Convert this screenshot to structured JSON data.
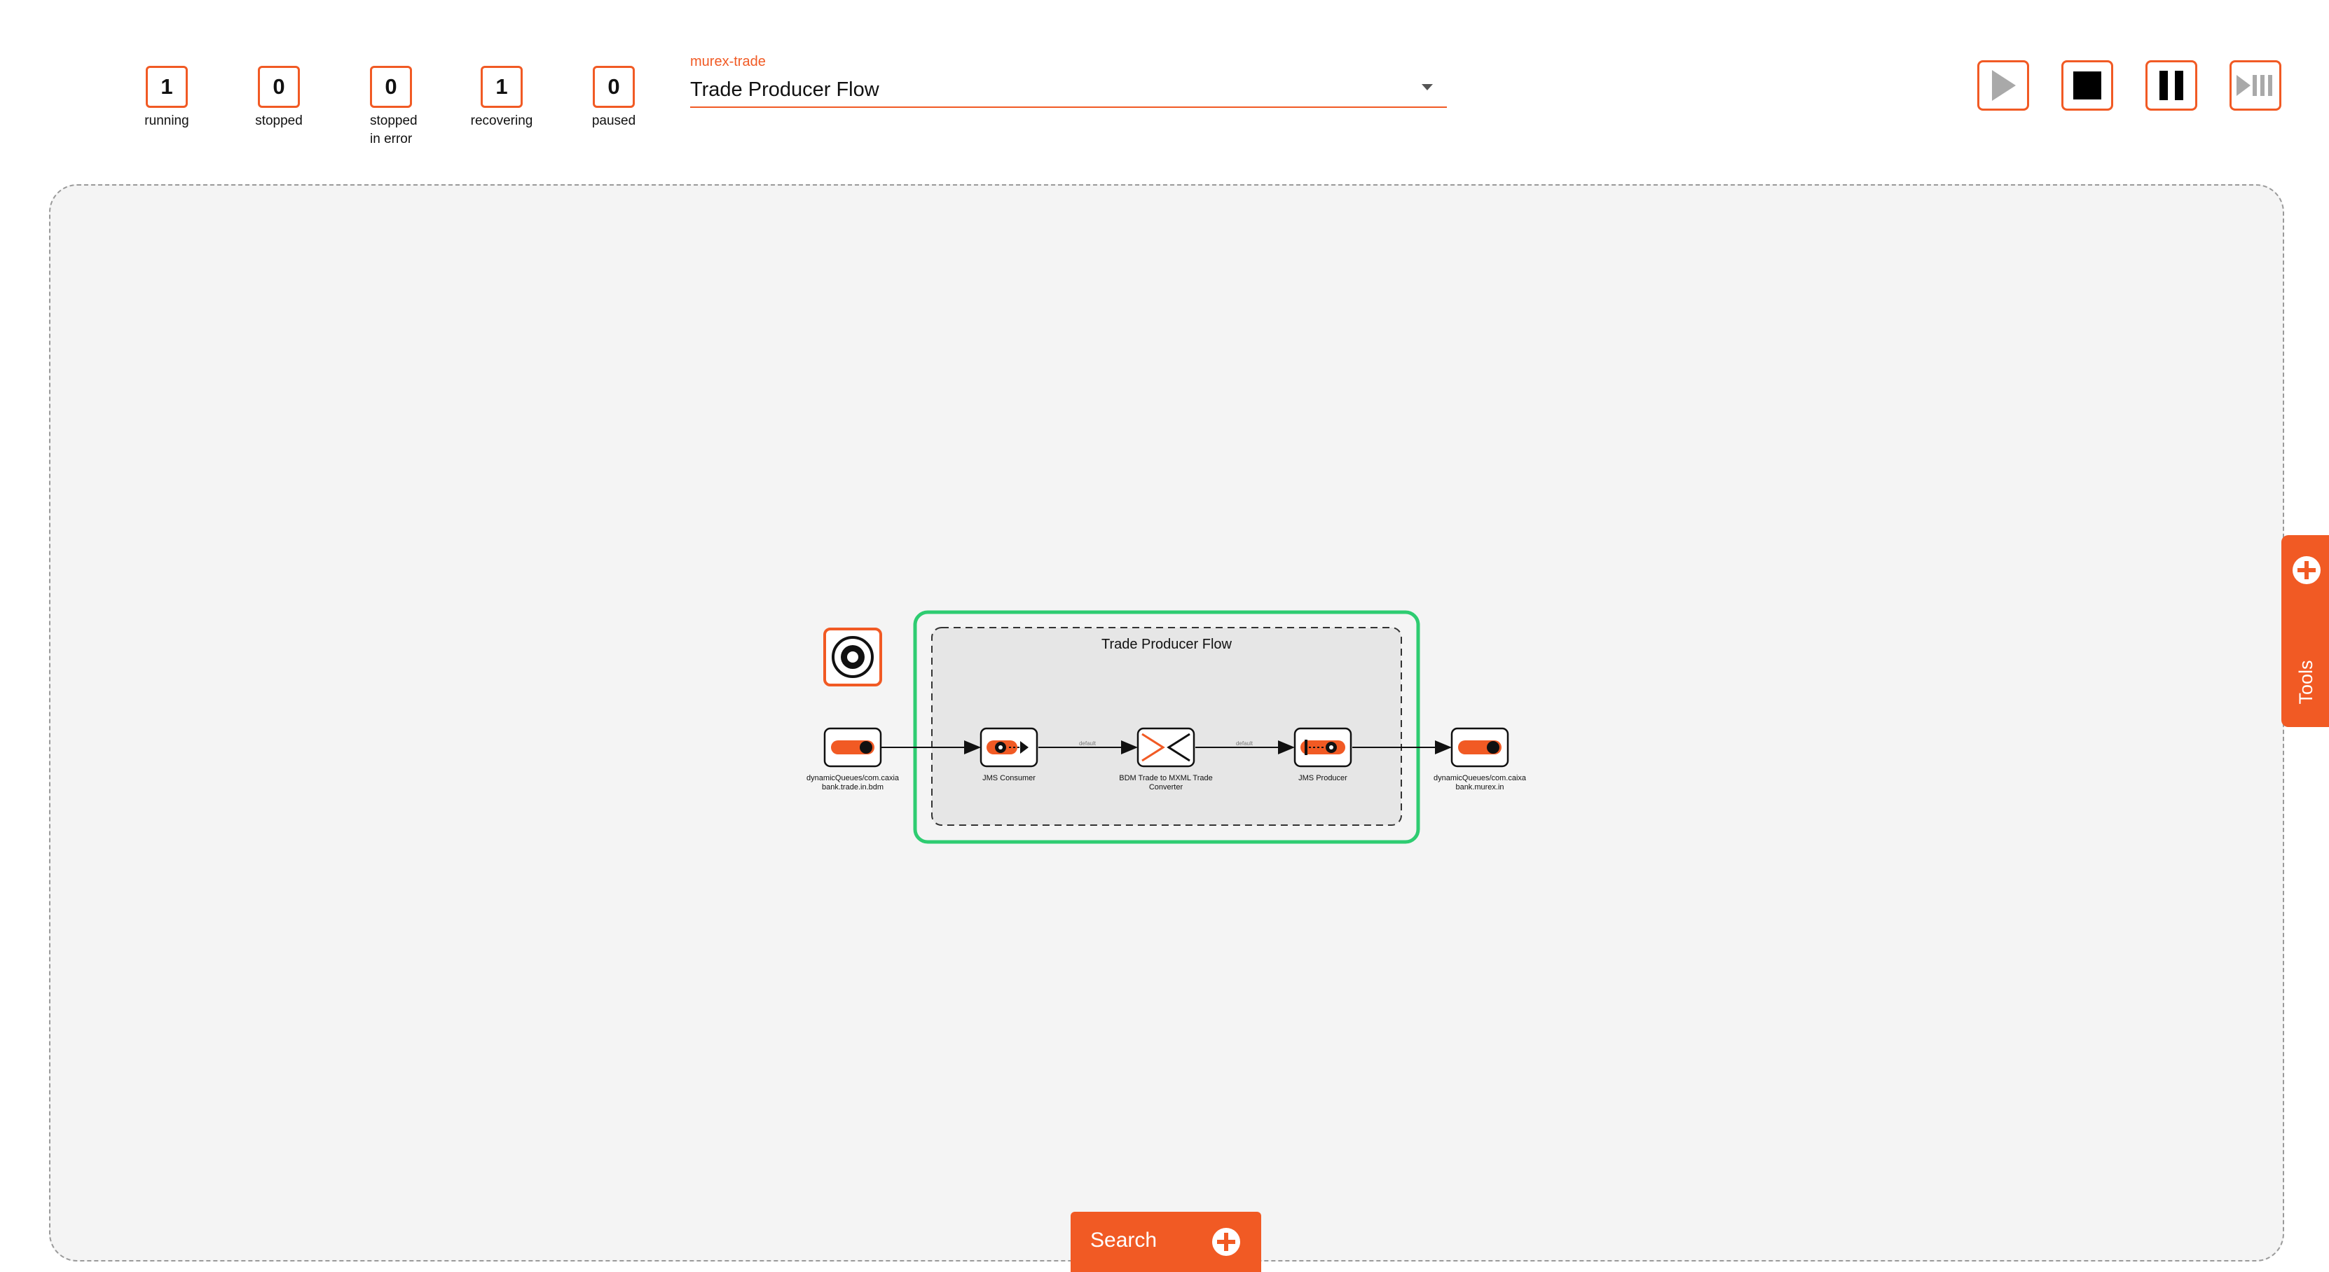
{
  "counters": [
    {
      "value": "1",
      "label": "running"
    },
    {
      "value": "0",
      "label": "stopped"
    },
    {
      "value": "0",
      "label": "stopped in error"
    },
    {
      "value": "1",
      "label": "recovering"
    },
    {
      "value": "0",
      "label": "paused"
    }
  ],
  "flow_select": {
    "caption": "murex-trade",
    "value": "Trade Producer Flow"
  },
  "controls": {
    "play": "play-icon",
    "stop": "stop-icon",
    "pause": "pause-icon",
    "step": "step-forward-icon"
  },
  "diagram": {
    "group_title": "Trade Producer Flow",
    "nodes": {
      "source": [
        "dynamicQueues/com.caxia",
        "bank.trade.in.bdm"
      ],
      "consumer": [
        "JMS Consumer"
      ],
      "converter": [
        "BDM Trade to MXML Trade",
        "Converter"
      ],
      "producer": [
        "JMS Producer"
      ],
      "target": [
        "dynamicQueues/com.caixa",
        "bank.murex.in"
      ]
    },
    "edge_labels": [
      "default",
      "default"
    ]
  },
  "tools_tab": {
    "label": "Tools"
  },
  "search_button": {
    "label": "Search"
  },
  "colors": {
    "accent": "#f15a24",
    "running_outline": "#2ecc71",
    "canvas_bg": "#f4f4f4",
    "group_bg": "#e6e6e6"
  }
}
